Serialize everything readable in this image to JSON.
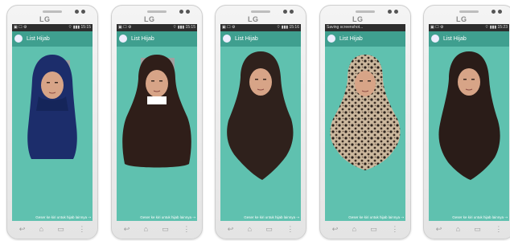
{
  "brand": "LG",
  "phones": [
    {
      "status_left": "▣ ☐ ⚙",
      "status_right": "⌔ ▮▮▮ 15:15",
      "app_title": "List Hijab",
      "footer_text": "Geser ke kiri untuk hijab lainnya ⇢"
    },
    {
      "status_left": "▣ ☐ ⚙",
      "status_right": "⌔ ▮▮▮ 15:15",
      "app_title": "List Hijab",
      "footer_text": "Geser ke kiri untuk hijab lainnya ⇢"
    },
    {
      "status_left": "▣ ☐ ⚙",
      "status_right": "⌔ ▮▮▮ 15:16",
      "app_title": "List Hijab",
      "footer_text": "Geser ke kiri untuk hijab lainnya ⇢"
    },
    {
      "status_left": "Saving screenshot...",
      "status_right": "",
      "app_title": "List Hijab",
      "footer_text": "Geser ke kiri untuk hijab lainnya ⇢"
    },
    {
      "status_left": "▣ ☐ ⚙",
      "status_right": "⌔ ▮▮▮ 15:23",
      "app_title": "List Hijab",
      "footer_text": "Geser ke kiri untuk hijab lainnya ⇢"
    }
  ],
  "navbar": {
    "back": "↩",
    "home": "⌂",
    "recent": "▭",
    "menu": "⋮"
  },
  "hijab_colors": [
    "#1c2d6b",
    "#2f1e19",
    "#2f211c",
    "#8a7260",
    "#2a1c18"
  ],
  "skin_color": "#d7a487"
}
